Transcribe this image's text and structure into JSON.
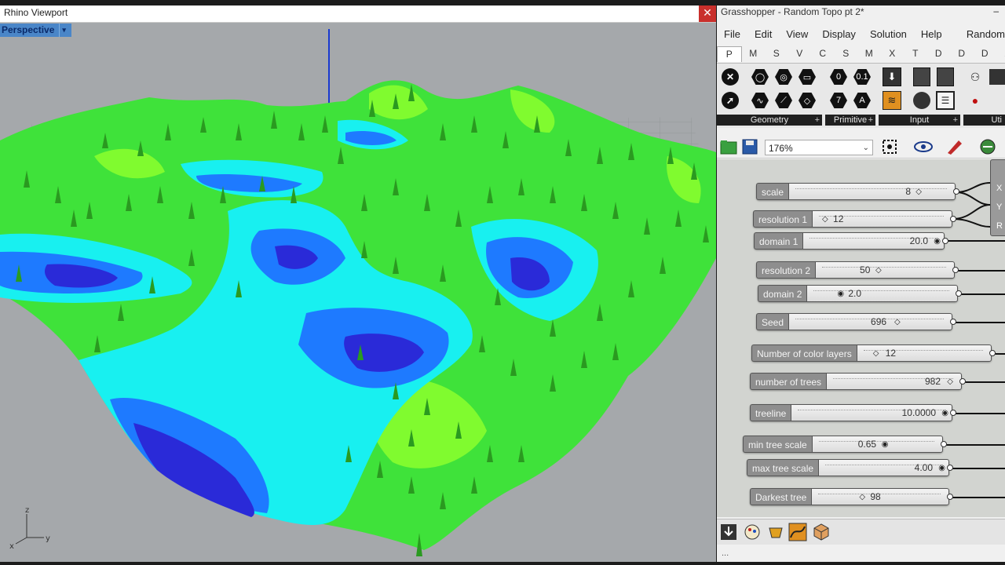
{
  "rhino": {
    "title": "Rhino Viewport",
    "close_glyph": "✕",
    "viewport_tab": "Perspective",
    "viewport_tab_arrow": "▾",
    "axes": {
      "x": "x",
      "y": "y",
      "z": "z"
    }
  },
  "grasshopper": {
    "title": "Grasshopper - Random Topo pt 2*",
    "window_control": "–",
    "menu": [
      "File",
      "Edit",
      "View",
      "Display",
      "Solution",
      "Help",
      "Random"
    ],
    "tabs": [
      "P",
      "M",
      "S",
      "V",
      "C",
      "S",
      "M",
      "X",
      "T",
      "D",
      "D",
      "D",
      "A"
    ],
    "active_tab": "P",
    "ribbon_groups": [
      {
        "label": "Geometry",
        "plus": "+"
      },
      {
        "label": "Primitive",
        "plus": "+"
      },
      {
        "label": "Input",
        "plus": "+"
      },
      {
        "label": "Uti",
        "plus": ""
      }
    ],
    "primitive_glyphs": {
      "a": "0",
      "b": "0.1",
      "c": "7",
      "d": "A"
    },
    "zoom": {
      "value": "176%",
      "arrow": "⌄"
    },
    "sliders": [
      {
        "label": "scale",
        "value": "8",
        "grip": "◇"
      },
      {
        "label": "resolution 1",
        "value": "12",
        "grip": "◇"
      },
      {
        "label": "domain 1",
        "value": "20.0",
        "grip": "◉"
      },
      {
        "label": "resolution 2",
        "value": "50",
        "grip": "◇"
      },
      {
        "label": "domain 2",
        "value": "2.0",
        "grip": "◉"
      },
      {
        "label": "Seed",
        "value": "696",
        "grip": "◇"
      },
      {
        "label": "Number of color layers",
        "value": "12",
        "grip": "◇"
      },
      {
        "label": "number of trees",
        "value": "982",
        "grip": "◇"
      },
      {
        "label": "treeline",
        "value": "10.0000",
        "grip": "◉"
      },
      {
        "label": "min tree scale",
        "value": "0.65",
        "grip": "◉"
      },
      {
        "label": "max tree scale",
        "value": "4.00",
        "grip": "◉"
      },
      {
        "label": "Darkest tree",
        "value": "98",
        "grip": "◇"
      }
    ],
    "node_ports": [
      "X",
      "Y",
      "R"
    ],
    "status": "..."
  },
  "colors": {
    "terrain_green": "#33e033",
    "terrain_light_green": "#8cff2e",
    "terrain_cyan": "#18f0f0",
    "terrain_blue": "#1e7aff",
    "terrain_deep_blue": "#2a2ad8",
    "tree_green": "#2a9a20",
    "viewport_bg": "#a5a8ab",
    "ribbon_label_bg": "#202020",
    "slider_label_bg": "#8e8e8e"
  }
}
